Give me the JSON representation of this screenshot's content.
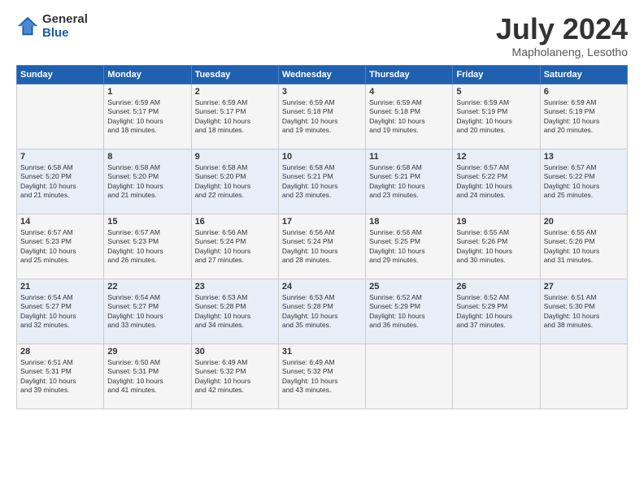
{
  "logo": {
    "general": "General",
    "blue": "Blue"
  },
  "title": "July 2024",
  "location": "Mapholaneng, Lesotho",
  "weekdays": [
    "Sunday",
    "Monday",
    "Tuesday",
    "Wednesday",
    "Thursday",
    "Friday",
    "Saturday"
  ],
  "weeks": [
    [
      {
        "day": "",
        "info": ""
      },
      {
        "day": "1",
        "info": "Sunrise: 6:59 AM\nSunset: 5:17 PM\nDaylight: 10 hours\nand 18 minutes."
      },
      {
        "day": "2",
        "info": "Sunrise: 6:59 AM\nSunset: 5:17 PM\nDaylight: 10 hours\nand 18 minutes."
      },
      {
        "day": "3",
        "info": "Sunrise: 6:59 AM\nSunset: 5:18 PM\nDaylight: 10 hours\nand 19 minutes."
      },
      {
        "day": "4",
        "info": "Sunrise: 6:59 AM\nSunset: 5:18 PM\nDaylight: 10 hours\nand 19 minutes."
      },
      {
        "day": "5",
        "info": "Sunrise: 6:59 AM\nSunset: 5:19 PM\nDaylight: 10 hours\nand 20 minutes."
      },
      {
        "day": "6",
        "info": "Sunrise: 6:59 AM\nSunset: 5:19 PM\nDaylight: 10 hours\nand 20 minutes."
      }
    ],
    [
      {
        "day": "7",
        "info": "Sunrise: 6:58 AM\nSunset: 5:20 PM\nDaylight: 10 hours\nand 21 minutes."
      },
      {
        "day": "8",
        "info": "Sunrise: 6:58 AM\nSunset: 5:20 PM\nDaylight: 10 hours\nand 21 minutes."
      },
      {
        "day": "9",
        "info": "Sunrise: 6:58 AM\nSunset: 5:20 PM\nDaylight: 10 hours\nand 22 minutes."
      },
      {
        "day": "10",
        "info": "Sunrise: 6:58 AM\nSunset: 5:21 PM\nDaylight: 10 hours\nand 23 minutes."
      },
      {
        "day": "11",
        "info": "Sunrise: 6:58 AM\nSunset: 5:21 PM\nDaylight: 10 hours\nand 23 minutes."
      },
      {
        "day": "12",
        "info": "Sunrise: 6:57 AM\nSunset: 5:22 PM\nDaylight: 10 hours\nand 24 minutes."
      },
      {
        "day": "13",
        "info": "Sunrise: 6:57 AM\nSunset: 5:22 PM\nDaylight: 10 hours\nand 25 minutes."
      }
    ],
    [
      {
        "day": "14",
        "info": "Sunrise: 6:57 AM\nSunset: 5:23 PM\nDaylight: 10 hours\nand 25 minutes."
      },
      {
        "day": "15",
        "info": "Sunrise: 6:57 AM\nSunset: 5:23 PM\nDaylight: 10 hours\nand 26 minutes."
      },
      {
        "day": "16",
        "info": "Sunrise: 6:56 AM\nSunset: 5:24 PM\nDaylight: 10 hours\nand 27 minutes."
      },
      {
        "day": "17",
        "info": "Sunrise: 6:56 AM\nSunset: 5:24 PM\nDaylight: 10 hours\nand 28 minutes."
      },
      {
        "day": "18",
        "info": "Sunrise: 6:56 AM\nSunset: 5:25 PM\nDaylight: 10 hours\nand 29 minutes."
      },
      {
        "day": "19",
        "info": "Sunrise: 6:55 AM\nSunset: 5:26 PM\nDaylight: 10 hours\nand 30 minutes."
      },
      {
        "day": "20",
        "info": "Sunrise: 6:55 AM\nSunset: 5:26 PM\nDaylight: 10 hours\nand 31 minutes."
      }
    ],
    [
      {
        "day": "21",
        "info": "Sunrise: 6:54 AM\nSunset: 5:27 PM\nDaylight: 10 hours\nand 32 minutes."
      },
      {
        "day": "22",
        "info": "Sunrise: 6:54 AM\nSunset: 5:27 PM\nDaylight: 10 hours\nand 33 minutes."
      },
      {
        "day": "23",
        "info": "Sunrise: 6:53 AM\nSunset: 5:28 PM\nDaylight: 10 hours\nand 34 minutes."
      },
      {
        "day": "24",
        "info": "Sunrise: 6:53 AM\nSunset: 5:28 PM\nDaylight: 10 hours\nand 35 minutes."
      },
      {
        "day": "25",
        "info": "Sunrise: 6:52 AM\nSunset: 5:29 PM\nDaylight: 10 hours\nand 36 minutes."
      },
      {
        "day": "26",
        "info": "Sunrise: 6:52 AM\nSunset: 5:29 PM\nDaylight: 10 hours\nand 37 minutes."
      },
      {
        "day": "27",
        "info": "Sunrise: 6:51 AM\nSunset: 5:30 PM\nDaylight: 10 hours\nand 38 minutes."
      }
    ],
    [
      {
        "day": "28",
        "info": "Sunrise: 6:51 AM\nSunset: 5:31 PM\nDaylight: 10 hours\nand 39 minutes."
      },
      {
        "day": "29",
        "info": "Sunrise: 6:50 AM\nSunset: 5:31 PM\nDaylight: 10 hours\nand 41 minutes."
      },
      {
        "day": "30",
        "info": "Sunrise: 6:49 AM\nSunset: 5:32 PM\nDaylight: 10 hours\nand 42 minutes."
      },
      {
        "day": "31",
        "info": "Sunrise: 6:49 AM\nSunset: 5:32 PM\nDaylight: 10 hours\nand 43 minutes."
      },
      {
        "day": "",
        "info": ""
      },
      {
        "day": "",
        "info": ""
      },
      {
        "day": "",
        "info": ""
      }
    ]
  ]
}
